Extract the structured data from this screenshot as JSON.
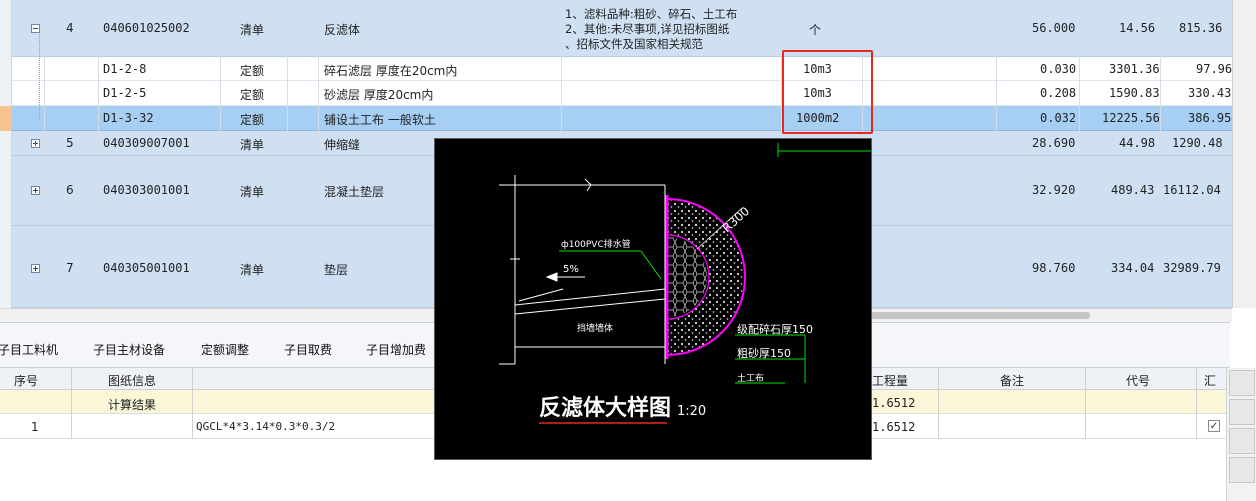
{
  "upper_grid": {
    "rows": [
      {
        "num": "4",
        "code": "040601025002",
        "type": "清单",
        "name": "反滤体",
        "feature": [
          "1、滤料品种:粗砂、碎石、土工布",
          "2、其他:未尽事项,详见招标图纸",
          "、招标文件及国家相关规范"
        ],
        "unit": "个",
        "qty": "56.000",
        "price": "14.56",
        "total": "815.36"
      },
      {
        "num": "",
        "code": "D1-2-8",
        "type": "定额",
        "name": "碎石滤层 厚度在20cm内",
        "feature": [],
        "unit": "10m3",
        "qty": "0.030",
        "price": "3301.36",
        "total": "97.96"
      },
      {
        "num": "",
        "code": "D1-2-5",
        "type": "定额",
        "name": "砂滤层 厚度20cm内",
        "feature": [],
        "unit": "10m3",
        "qty": "0.208",
        "price": "1590.83",
        "total": "330.43"
      },
      {
        "num": "",
        "code": "D1-3-32",
        "type": "定额",
        "name": "铺设土工布 一般软土",
        "feature": [],
        "unit": "1000m2",
        "qty": "0.032",
        "price": "12225.56",
        "total": "386.95"
      },
      {
        "num": "5",
        "code": "040309007001",
        "type": "清单",
        "name": "伸缩缝",
        "feature": [],
        "unit": "",
        "qty": "28.690",
        "price": "44.98",
        "total": "1290.48"
      },
      {
        "num": "6",
        "code": "040303001001",
        "type": "清单",
        "name": "混凝土垫层",
        "feature": [],
        "unit": "",
        "qty": "32.920",
        "price": "489.43",
        "total": "16112.04"
      },
      {
        "num": "7",
        "code": "040305001001",
        "type": "清单",
        "name": "垫层",
        "feature": [],
        "unit": "",
        "qty": "98.760",
        "price": "334.04",
        "total": "32989.79"
      }
    ]
  },
  "bottom_tabs": [
    "子目工料机",
    "子目主材设备",
    "定额调整",
    "子目取费",
    "子目增加费"
  ],
  "lower_grid": {
    "headers": {
      "seq": "序号",
      "drawing": "图纸信息",
      "qty": "工程量",
      "note": "备注",
      "code": "代号",
      "sum": "汇"
    },
    "result_label": "计算结果",
    "result_qty": "1.6512",
    "row": {
      "seq": "1",
      "formula": "QGCL*4*3.14*0.3*0.3/2",
      "qty": "1.6512"
    }
  },
  "drawing": {
    "title": "反滤体大样图",
    "scale": "1:20",
    "radius": "R300",
    "pipe": "ф100PVC排水管",
    "slope": "5%",
    "wall": "挡墙墙体",
    "gravel": "级配碎石厚150",
    "sand": "粗砂厚150",
    "geotextile": "土工布"
  },
  "colors": {
    "row_blue": "#cfe0f3",
    "row_selected": "#a7cff4",
    "highlight_red": "#e8281e",
    "cad_background": "#000000",
    "cad_magenta": "#ff00ff",
    "cad_green": "#00e000"
  }
}
